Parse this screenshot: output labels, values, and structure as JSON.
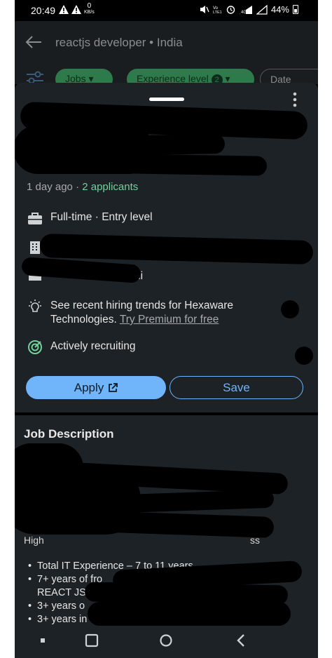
{
  "status_bar": {
    "time": "20:49",
    "network_speed_value": "0",
    "network_speed_unit": "KB/s",
    "battery": "44%"
  },
  "search_header": {
    "query": "reactjs developer • India",
    "chips": [
      "Jobs",
      "Experience level",
      "Date posted"
    ],
    "experience_count": "2"
  },
  "job": {
    "posted": "1 day ago",
    "separator": "·",
    "applicants": "2 applicants",
    "employment": "Full-time · Entry level",
    "partial_location_fragment": "ni",
    "hiring_trends_text": "See recent hiring trends for Hexaware Technologies.",
    "premium_link": "Try Premium for free",
    "recruiting_status": "Actively recruiting"
  },
  "actions": {
    "apply_label": "Apply",
    "save_label": "Save"
  },
  "description": {
    "title": "Job Description",
    "partial_line_start": "High",
    "partial_line_end": "ss",
    "bullets": [
      "Total IT Experience – 7 to 11 years",
      "7+ years of fro",
      "REACT JS",
      "3+ years o",
      "3+ years in"
    ]
  },
  "colors": {
    "sheet_bg": "#1d2226",
    "accent_blue": "#70b5f9",
    "accent_green": "#6fd39a"
  }
}
